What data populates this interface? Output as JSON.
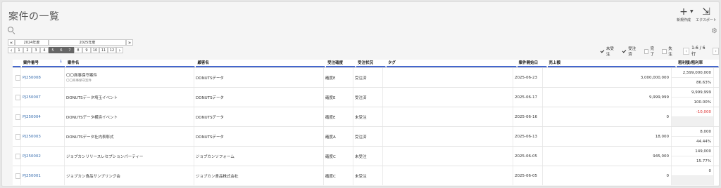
{
  "header": {
    "title": "案件の一覧",
    "new_label": "新規作成",
    "export_label": "エクスポート"
  },
  "picker": {
    "years": [
      "2024年度",
      "2025年度"
    ],
    "months": [
      "1",
      "2",
      "3",
      "4",
      "5",
      "6",
      "7",
      "8",
      "9",
      "10",
      "11",
      "12"
    ],
    "selected_months": [
      "5",
      "6",
      "7"
    ]
  },
  "filters": {
    "items": [
      {
        "label": "未受注",
        "checked": true
      },
      {
        "label": "受注済",
        "checked": true
      },
      {
        "label": "完了",
        "checked": false
      },
      {
        "label": "失注",
        "checked": false
      }
    ],
    "page_count": "1-6 / 6 行"
  },
  "table": {
    "headers": [
      "案件番号",
      "案件名",
      "顧客名",
      "受注確度",
      "受注状況",
      "タグ",
      "案件開始日",
      "売上額",
      "粗利額/粗利率"
    ],
    "rows": [
      {
        "id": "PJ250008",
        "name": "〇〇商事保守案件",
        "sub": "〇〇商事保守案件",
        "customer": "DONUTSデータ",
        "prob": "確度E",
        "status": "受注済",
        "tag": "",
        "date": "2025-06-23",
        "sales": "3,000,000,000",
        "profit": "2,599,000,000",
        "rate": "86.63%"
      },
      {
        "id": "PJ250007",
        "name": "DONUTSデータ埼玉イベント",
        "sub": "",
        "customer": "DONUTSデータ",
        "prob": "確度E",
        "status": "受注済",
        "tag": "",
        "date": "2025-06-17",
        "sales": "9,999,999",
        "profit": "9,999,999",
        "rate": "100.00%"
      },
      {
        "id": "PJ250004",
        "name": "DONUTSデータ横浜イベント",
        "sub": "",
        "customer": "DONUTSデータ",
        "prob": "確度E",
        "status": "未受注",
        "tag": "",
        "date": "2025-06-16",
        "sales": "0",
        "profit": "-10,000",
        "rate": ""
      },
      {
        "id": "PJ250003",
        "name": "DONUTSデータ社内表彰式",
        "sub": "",
        "customer": "DONUTSデータ",
        "prob": "確度A",
        "status": "受注済",
        "tag": "",
        "date": "2025-06-13",
        "sales": "18,000",
        "profit": "8,000",
        "rate": "44.44%"
      },
      {
        "id": "PJ250002",
        "name": "ジョブカンリリースレセプションパーティー",
        "sub": "",
        "customer": "ジョブカンソフォーム",
        "prob": "確度C",
        "status": "未受注",
        "tag": "",
        "date": "2025-06-05",
        "sales": "945,000",
        "profit": "149,000",
        "rate": "15.77%"
      },
      {
        "id": "PJ250001",
        "name": "ジョブカン食品サンプリング会",
        "sub": "",
        "customer": "ジョブカン食品株式会社",
        "prob": "確度C",
        "status": "未受注",
        "tag": "",
        "date": "2025-06-05",
        "sales": "0",
        "profit": "0",
        "rate": ""
      }
    ]
  },
  "colors": {
    "accent": "#4466cc",
    "link": "#3a6fb0",
    "negative": "#dd3333"
  }
}
